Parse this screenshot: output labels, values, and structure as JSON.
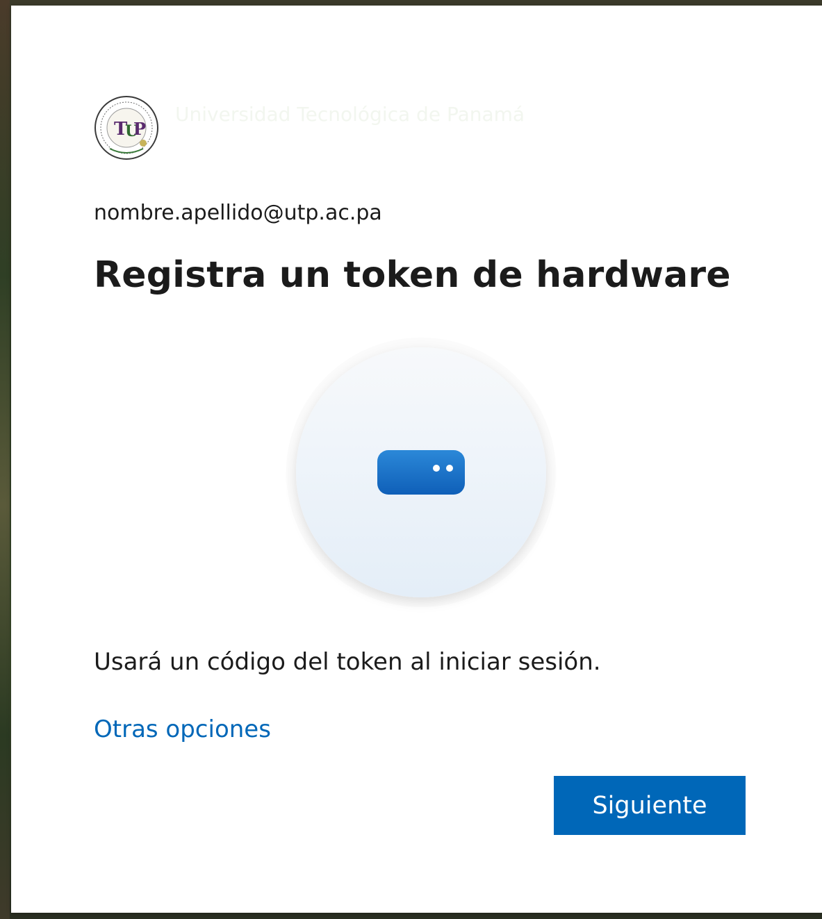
{
  "organization": {
    "logo_icon": "utp-seal-logo",
    "name": "Universidad Tecnológica de Panamá"
  },
  "account": {
    "email": "nombre.apellido@utp.ac.pa"
  },
  "page": {
    "title": "Registra un token de hardware",
    "illustration_icon": "hardware-token-icon",
    "description": "Usará un código del token al iniciar sesión."
  },
  "actions": {
    "other_options_label": "Otras opciones",
    "next_label": "Siguiente"
  },
  "colors": {
    "accent": "#0067b8",
    "text": "#1b1b1b",
    "background": "#ffffff"
  }
}
